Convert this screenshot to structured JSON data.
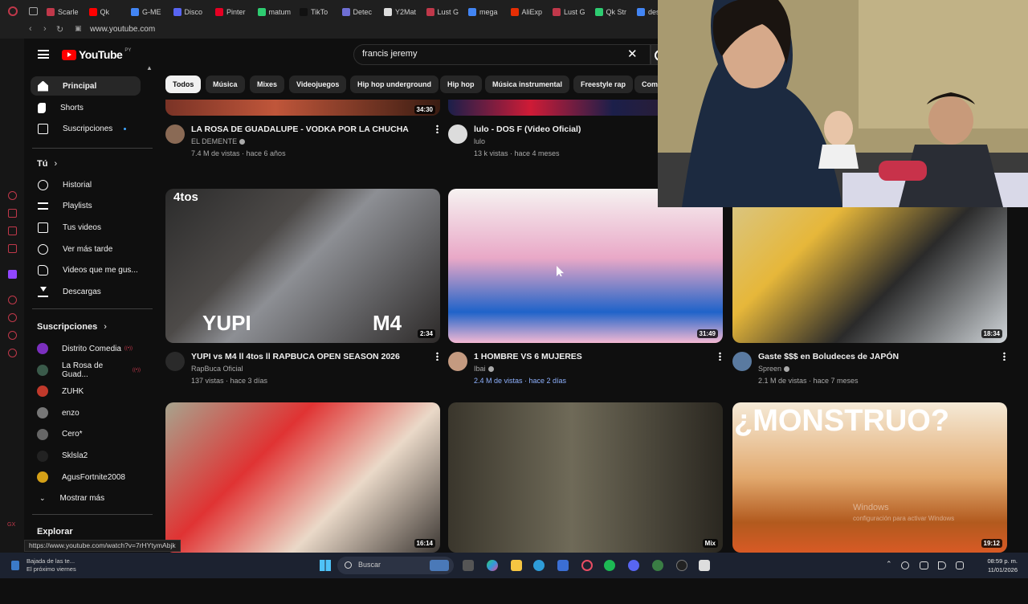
{
  "browser": {
    "tabs": [
      "Scarle",
      "Qk",
      "G-ME",
      "Disco",
      "Pinter",
      "matum",
      "TikTo",
      "Detec",
      "Y2Mat",
      "Lust G",
      "mega",
      "AliExp",
      "Lust G",
      "Qk Str",
      "desifr"
    ],
    "url": "www.youtube.com"
  },
  "header": {
    "logo_text": "YouTube",
    "country_code": "PY",
    "search_query": "francis jeremy"
  },
  "sidebar": {
    "main_items": [
      {
        "label": "Principal",
        "icon": "home-icon"
      },
      {
        "label": "Shorts",
        "icon": "shorts-icon"
      },
      {
        "label": "Suscripciones",
        "icon": "subscriptions-icon"
      }
    ],
    "you_section_title": "Tú",
    "you_items": [
      {
        "label": "Historial",
        "icon": "history-icon"
      },
      {
        "label": "Playlists",
        "icon": "playlists-icon"
      },
      {
        "label": "Tus videos",
        "icon": "your-videos-icon"
      },
      {
        "label": "Ver más tarde",
        "icon": "watch-later-icon"
      },
      {
        "label": "Videos que me gus...",
        "icon": "liked-icon"
      },
      {
        "label": "Descargas",
        "icon": "downloads-icon"
      }
    ],
    "subs_section_title": "Suscripciones",
    "subscriptions": [
      {
        "label": "Distrito Comedia",
        "live": true,
        "color": "#7b2fbe"
      },
      {
        "label": "La Rosa de Guad...",
        "live": true,
        "color": "#3a5a4a"
      },
      {
        "label": "ZUHK",
        "live": false,
        "color": "#c0392b"
      },
      {
        "label": "enzo",
        "live": false,
        "color": "#777777"
      },
      {
        "label": "Cero*",
        "live": false,
        "color": "#666666"
      },
      {
        "label": "Sklsla2",
        "live": false,
        "color": "#222222"
      },
      {
        "label": "AgusFortnite2008",
        "live": false,
        "color": "#d4a017"
      }
    ],
    "show_more_label": "Mostrar más",
    "explore_title": "Explorar"
  },
  "chips": [
    "Todos",
    "Música",
    "Mixes",
    "Videojuegos",
    "Hip hop underground",
    "Hip hop",
    "Música instrumental",
    "Freestyle rap",
    "Com"
  ],
  "videos": [
    {
      "title": "LA ROSA DE GUADALUPE - VODKA POR LA CHUCHA",
      "channel": "EL DEMENTE",
      "meta": "7.4 M de vistas · hace 6 años",
      "duration": "34:30",
      "verified": true
    },
    {
      "title": "lulo - DOS F (Video Oficial)",
      "channel": "lulo",
      "meta": "13 k vistas · hace 4 meses",
      "duration": "",
      "verified": false
    },
    {
      "title": "YUPI vs M4 ll 4tos ll RAPBUCA OPEN SEASON 2026",
      "channel": "RapBuca Oficial",
      "meta": "137 vistas · hace 3 días",
      "duration": "2:34",
      "verified": false
    },
    {
      "title": "1 HOMBRE VS 6 MUJERES",
      "channel": "Ibai",
      "meta": "2.4 M de vistas · hace 2 días",
      "duration": "31:49",
      "verified": true
    },
    {
      "title": "Gaste $$$ en Boludeces de JAPÓN",
      "channel": "Spreen",
      "meta": "2.1 M de vistas · hace 7 meses",
      "duration": "18:34",
      "verified": true
    },
    {
      "duration": "16:14"
    },
    {
      "duration": "Mix"
    },
    {
      "duration": "19:12"
    }
  ],
  "thumb_text": {
    "yupi": "YUPI",
    "m4": "M4",
    "tos": "4tos",
    "monstruo": "¿MONSTRUO?"
  },
  "status_url": "https://www.youtube.com/watch?v=7rHYtymAbjk",
  "watermark": {
    "line1": "Windows",
    "line2": "configuración para activar Windows"
  },
  "taskbar": {
    "weather_line1": "Bajada de las te...",
    "weather_line2": "El próximo viernes",
    "search_placeholder": "Buscar",
    "time": "08:59 p. m.",
    "date": "11/01/2026"
  }
}
